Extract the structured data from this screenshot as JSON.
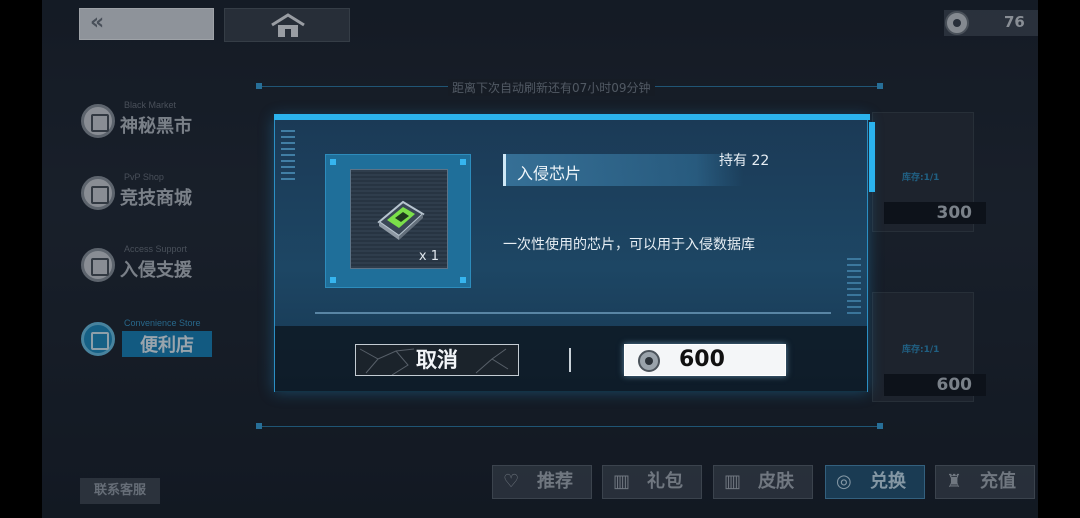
{
  "header": {
    "back_glyph": "«",
    "currency_value": "76"
  },
  "shop": {
    "refresh_text": "距离下次自动刷新还有07小时09分钟",
    "cards": [
      {
        "stock": "库存:1/1",
        "price": "300"
      },
      {
        "stock": "库存:1/1",
        "price": "600"
      }
    ]
  },
  "sidebar": {
    "items": [
      {
        "sub": "Black Market",
        "label": "神秘黑市"
      },
      {
        "sub": "PvP Shop",
        "label": "竞技商城"
      },
      {
        "sub": "Access Support",
        "label": "入侵支援"
      },
      {
        "sub": "Convenience Store",
        "label": "便利店"
      }
    ],
    "support_label": "联系客服"
  },
  "tabs": [
    {
      "icon": "heart-icon",
      "glyph": "♡",
      "label": "推荐"
    },
    {
      "icon": "gift-icon",
      "glyph": "▥",
      "label": "礼包"
    },
    {
      "icon": "skin-icon",
      "glyph": "▥",
      "label": "皮肤"
    },
    {
      "icon": "exchange-icon",
      "glyph": "◎",
      "label": "兑换"
    },
    {
      "icon": "recharge-icon",
      "glyph": "♜",
      "label": "充值"
    }
  ],
  "dialog": {
    "item_name": "入侵芯片",
    "owned_text": "持有 22",
    "quantity": "x 1",
    "description": "一次性使用的芯片，可以用于入侵数据库",
    "cancel_label": "取消",
    "price": "600"
  },
  "colors": {
    "accent": "#2bb3ee",
    "panel": "#1d4664",
    "chip_green": "#7be04a"
  }
}
